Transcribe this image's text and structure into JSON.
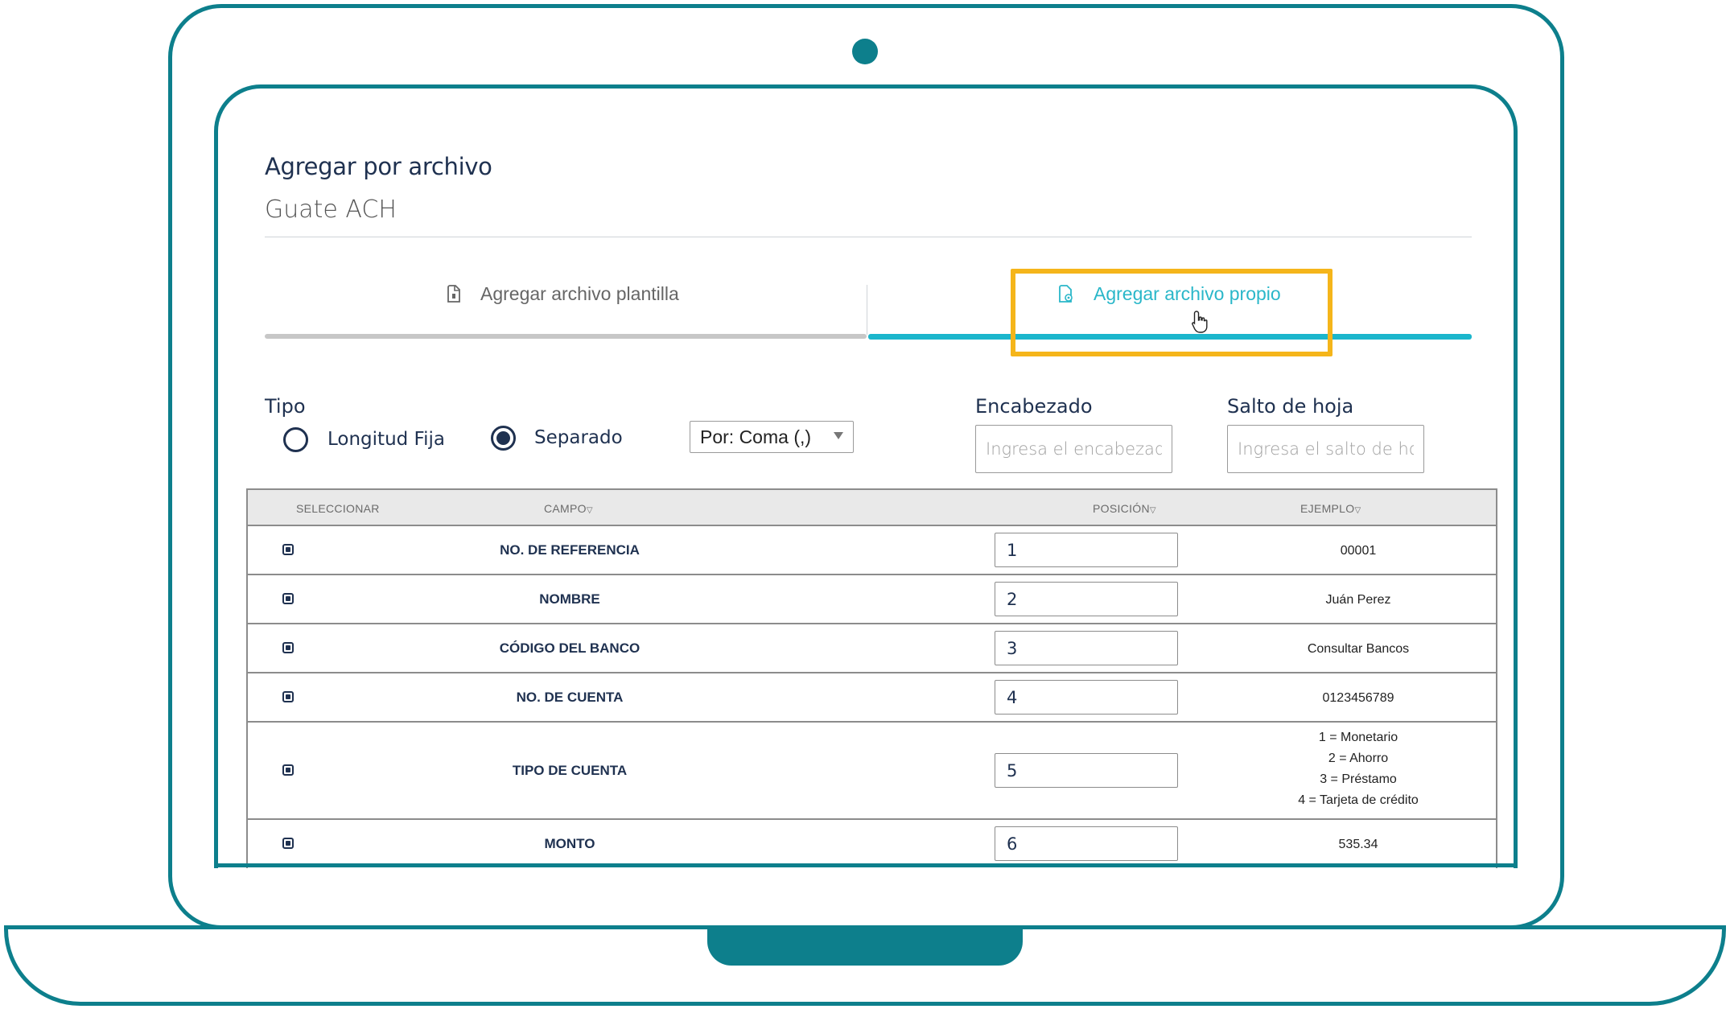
{
  "header": {
    "title": "Agregar por archivo",
    "subtitle": "Guate ACH"
  },
  "tabs": [
    {
      "label": "Agregar archivo plantilla",
      "icon": "file-icon",
      "active": false
    },
    {
      "label": "Agregar archivo propio",
      "icon": "file-settings-icon",
      "active": true
    }
  ],
  "form": {
    "tipo_label": "Tipo",
    "options": [
      {
        "label": "Longitud Fija",
        "selected": false
      },
      {
        "label": "Separado",
        "selected": true
      }
    ],
    "separator_select": "Por: Coma (,)",
    "encabezado_label": "Encabezado",
    "encabezado_placeholder": "Ingresa el encabezado",
    "salto_label": "Salto de hoja",
    "salto_placeholder": "Ingresa el salto de hoja"
  },
  "table": {
    "headers": {
      "select": "SELECCIONAR",
      "field": "CAMPO",
      "position": "POSICIÓN",
      "example": "EJEMPLO"
    },
    "rows": [
      {
        "field": "NO. DE REFERENCIA",
        "position": "1",
        "example": [
          "00001"
        ]
      },
      {
        "field": "NOMBRE",
        "position": "2",
        "example": [
          "Juán Perez"
        ]
      },
      {
        "field": "CÓDIGO DEL BANCO",
        "position": "3",
        "example": [
          "Consultar Bancos"
        ]
      },
      {
        "field": "NO. DE CUENTA",
        "position": "4",
        "example": [
          "0123456789"
        ]
      },
      {
        "field": "TIPO DE CUENTA",
        "position": "5",
        "example": [
          "1 = Monetario",
          "2 = Ahorro",
          "3 = Préstamo",
          "4 = Tarjeta de crédito"
        ]
      },
      {
        "field": "MONTO",
        "position": "6",
        "example": [
          "535.34"
        ]
      }
    ]
  },
  "colors": {
    "frame": "#0d7f8c",
    "accent": "#1bb6cc",
    "highlight": "#f5b51a",
    "text": "#1f3150"
  }
}
